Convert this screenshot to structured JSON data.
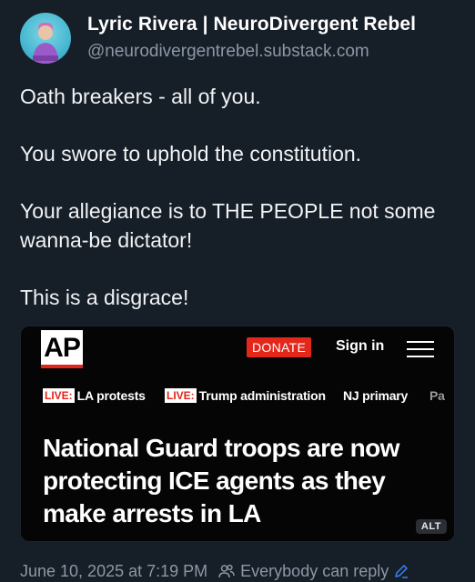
{
  "author": {
    "name": "Lyric Rivera | NeuroDivergent Rebel",
    "handle": "@neurodivergentrebel.substack.com",
    "avatar_caption": "Lyric Rivera"
  },
  "post": {
    "paragraphs": [
      "Oath breakers - all of you.",
      "You swore to uphold the constitution.",
      "Your allegiance is to THE PEOPLE not some wanna-be dictator!",
      "This is a disgrace!"
    ]
  },
  "embed": {
    "logo": "AP",
    "donate_label": "DONATE",
    "signin_label": "Sign in",
    "nav": [
      {
        "live": "LIVE:",
        "label": "LA protests"
      },
      {
        "live": "LIVE:",
        "label": "Trump administration"
      },
      {
        "live": "",
        "label": "NJ primary"
      },
      {
        "live": "",
        "label": "Pa"
      }
    ],
    "headline": "National Guard troops are now protecting ICE agents as they make arrests in LA",
    "alt_label": "ALT"
  },
  "footer": {
    "timestamp": "June 10, 2025 at 7:19 PM",
    "reply_setting": "Everybody can reply"
  },
  "colors": {
    "background": "#161e27",
    "ap_red": "#e1251b",
    "muted_text": "#8b98a5",
    "link_blue": "#3b82f6"
  },
  "icons": [
    "menu-icon",
    "people-icon",
    "pencil-icon"
  ]
}
